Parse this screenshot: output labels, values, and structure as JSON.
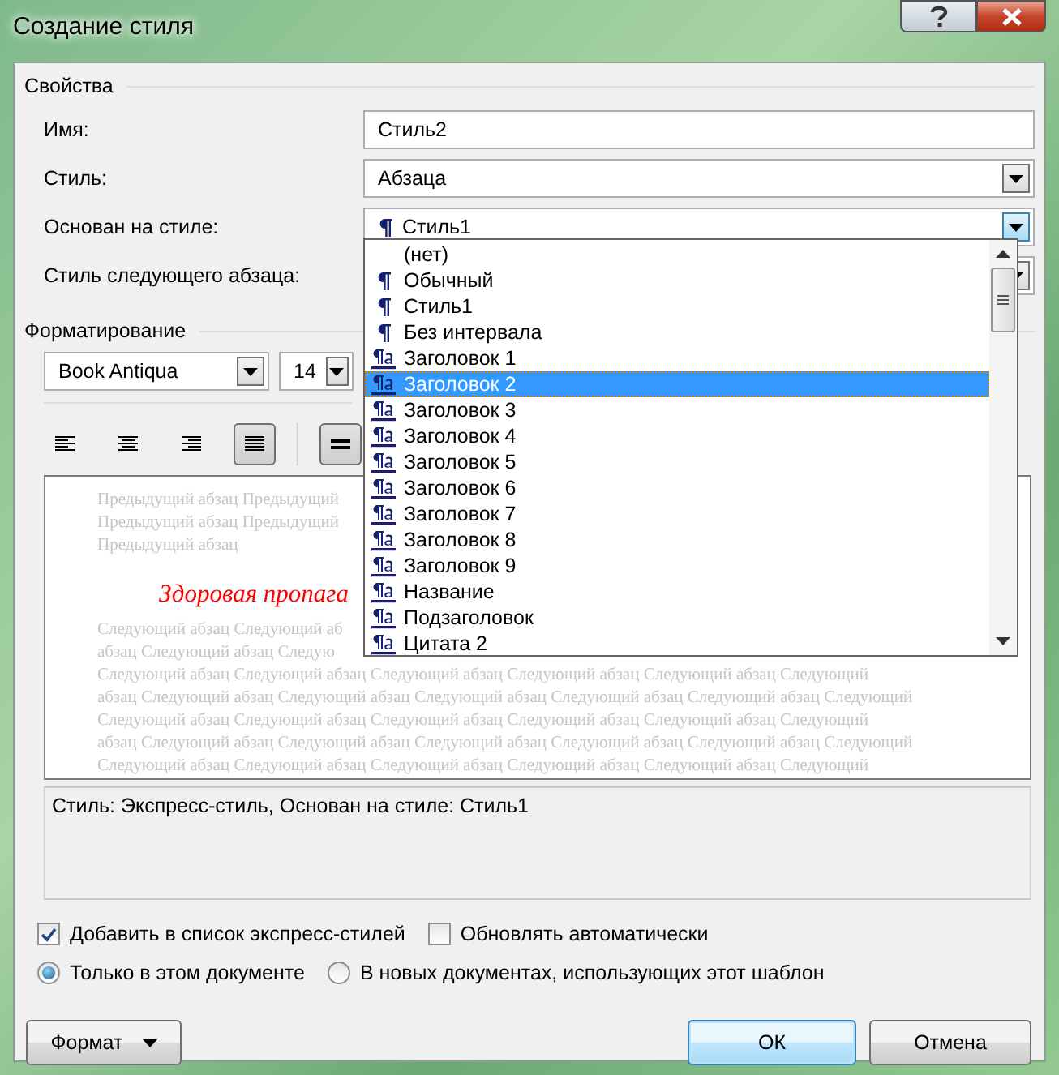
{
  "window": {
    "title": "Создание стиля"
  },
  "properties": {
    "heading": "Свойства",
    "fields": [
      {
        "label": "Имя:",
        "kind": "text",
        "value": "Стиль2"
      },
      {
        "label": "Стиль:",
        "kind": "combo",
        "value": "Абзаца",
        "expanded": false
      },
      {
        "label": "Основан на стиле:",
        "kind": "paragraph_style_combo",
        "value": "Стиль1",
        "expanded": true
      },
      {
        "label": "Стиль следующего абзаца:",
        "kind": "combo",
        "expanded": false
      }
    ]
  },
  "style_list": {
    "items": [
      {
        "label": "(нет)",
        "kind": "none",
        "selected": false
      },
      {
        "label": "Обычный",
        "kind": "paragraph",
        "selected": false
      },
      {
        "label": "Стиль1",
        "kind": "paragraph",
        "selected": false
      },
      {
        "label": "Без интервала",
        "kind": "paragraph",
        "selected": false
      },
      {
        "label": "Заголовок 1",
        "kind": "linked",
        "selected": false
      },
      {
        "label": "Заголовок 2",
        "kind": "linked",
        "selected": true
      },
      {
        "label": "Заголовок 3",
        "kind": "linked",
        "selected": false
      },
      {
        "label": "Заголовок 4",
        "kind": "linked",
        "selected": false
      },
      {
        "label": "Заголовок 5",
        "kind": "linked",
        "selected": false
      },
      {
        "label": "Заголовок 6",
        "kind": "linked",
        "selected": false
      },
      {
        "label": "Заголовок 7",
        "kind": "linked",
        "selected": false
      },
      {
        "label": "Заголовок 8",
        "kind": "linked",
        "selected": false
      },
      {
        "label": "Заголовок 9",
        "kind": "linked",
        "selected": false
      },
      {
        "label": "Название",
        "kind": "linked",
        "selected": false
      },
      {
        "label": "Подзаголовок",
        "kind": "linked",
        "selected": false
      },
      {
        "label": "Цитата 2",
        "kind": "linked",
        "selected": false
      }
    ]
  },
  "formatting": {
    "heading": "Форматирование",
    "font": "Book Antiqua",
    "size": "14",
    "buttons": [
      {
        "kind": "align-left",
        "selected": false
      },
      {
        "kind": "align-center",
        "selected": false
      },
      {
        "kind": "align-right",
        "selected": false
      },
      {
        "kind": "justify",
        "selected": true
      },
      {
        "kind": "single-spacing",
        "selected": true
      }
    ]
  },
  "preview": {
    "previous_lines": [
      "Предыдущий абзац Предыдущий",
      "Предыдущий абзац Предыдущий",
      "Предыдущий абзац"
    ],
    "heading": "Здоровая пропага",
    "next_lines": [
      "Следующий абзац Следующий аб",
      "абзац Следующий абзац Следую",
      "Следующий абзац Следующий абзац Следующий абзац Следующий абзац Следующий абзац Следующий",
      "абзац Следующий абзац Следующий абзац Следующий абзац Следующий абзац Следующий абзац Следующий",
      "Следующий абзац Следующий абзац Следующий абзац Следующий абзац Следующий абзац Следующий",
      "абзац Следующий абзац Следующий абзац Следующий абзац Следующий абзац Следующий абзац Следующий",
      "Следующий абзац Следующий абзац Следующий абзац Следующий абзац Следующий абзац Следующий"
    ]
  },
  "description": "Стиль: Экспресс-стиль, Основан на стиле: Стиль1",
  "checkboxes": [
    {
      "label": "Добавить в список экспресс-стилей",
      "checked": true
    },
    {
      "label": "Обновлять автоматически",
      "checked": false
    }
  ],
  "radios": [
    {
      "label": "Только в этом документе",
      "selected": true
    },
    {
      "label": "В новых документах, использующих этот шаблон",
      "selected": false
    }
  ],
  "buttons": [
    {
      "label": "Формат",
      "kind": "menu"
    },
    {
      "label": "ОК",
      "kind": "default"
    },
    {
      "label": "Отмена",
      "kind": "normal"
    }
  ]
}
